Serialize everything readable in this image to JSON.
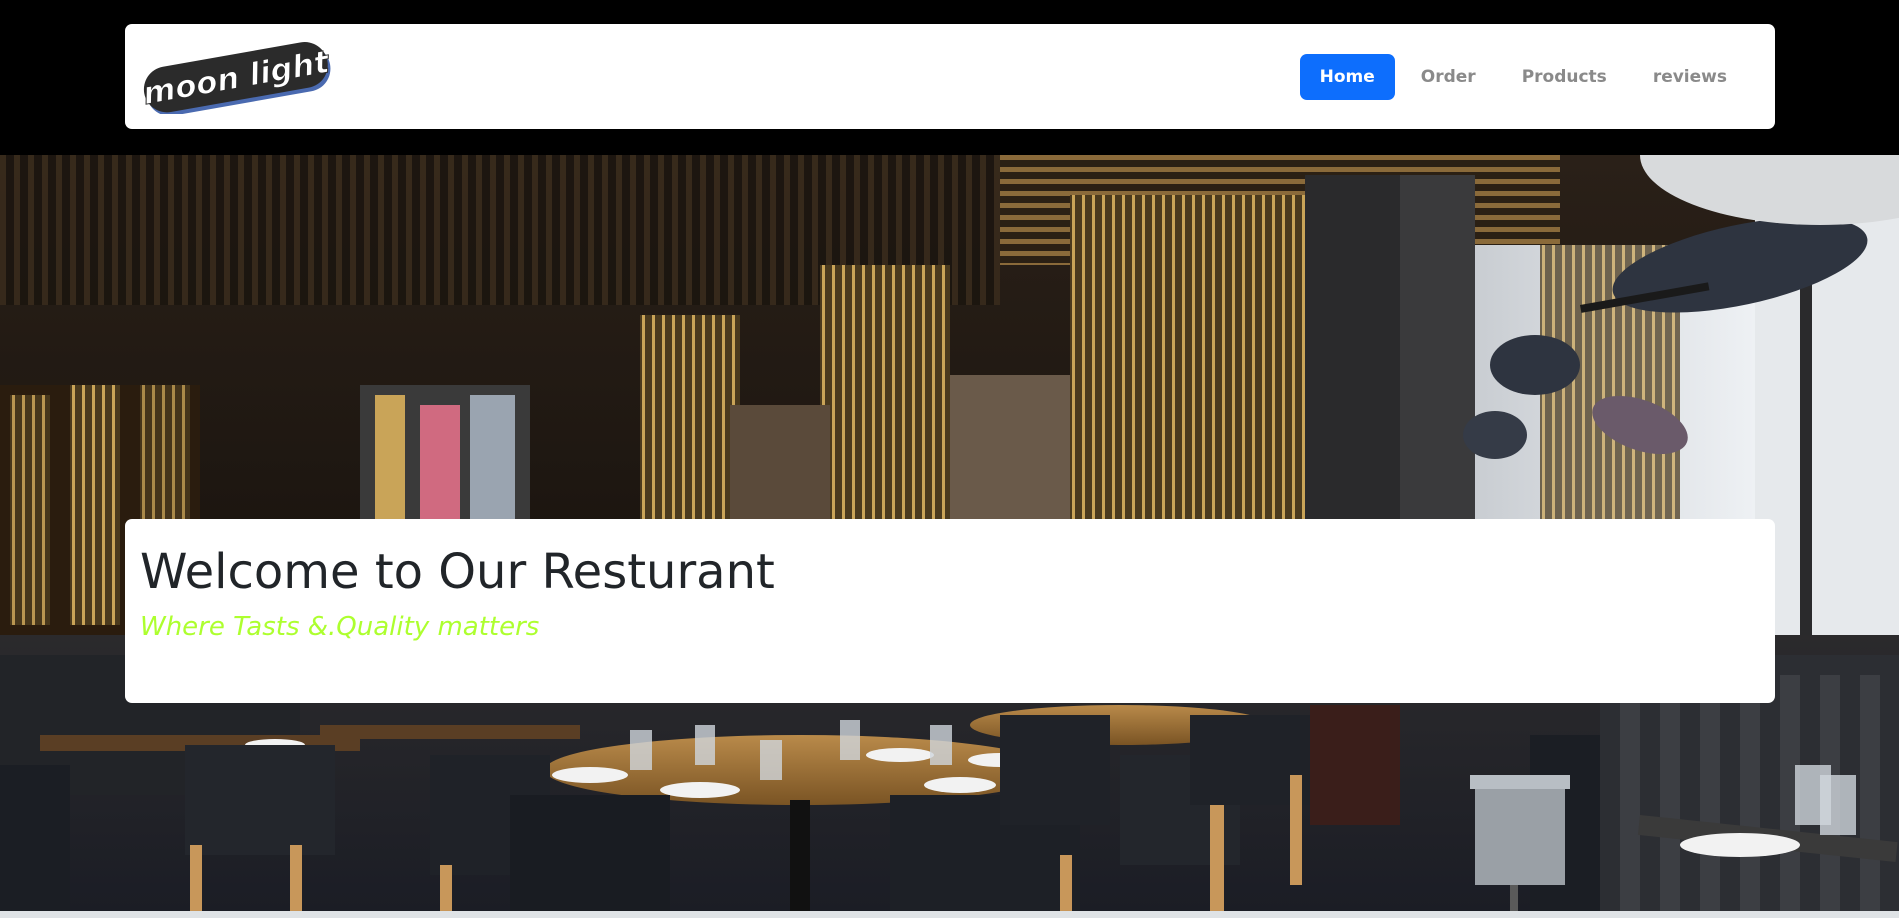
{
  "logo": {
    "text": "moon light"
  },
  "nav": {
    "items": [
      {
        "label": "Home",
        "active": true
      },
      {
        "label": "Order",
        "active": false
      },
      {
        "label": "Products",
        "active": false
      },
      {
        "label": "reviews",
        "active": false
      }
    ]
  },
  "hero": {
    "title": "Welcome to Our Resturant",
    "subtitle": "Where Tasts &.Quality matters"
  },
  "colors": {
    "accent": "#0d6efd",
    "subtitle": "#adff2f",
    "title": "#212529"
  }
}
